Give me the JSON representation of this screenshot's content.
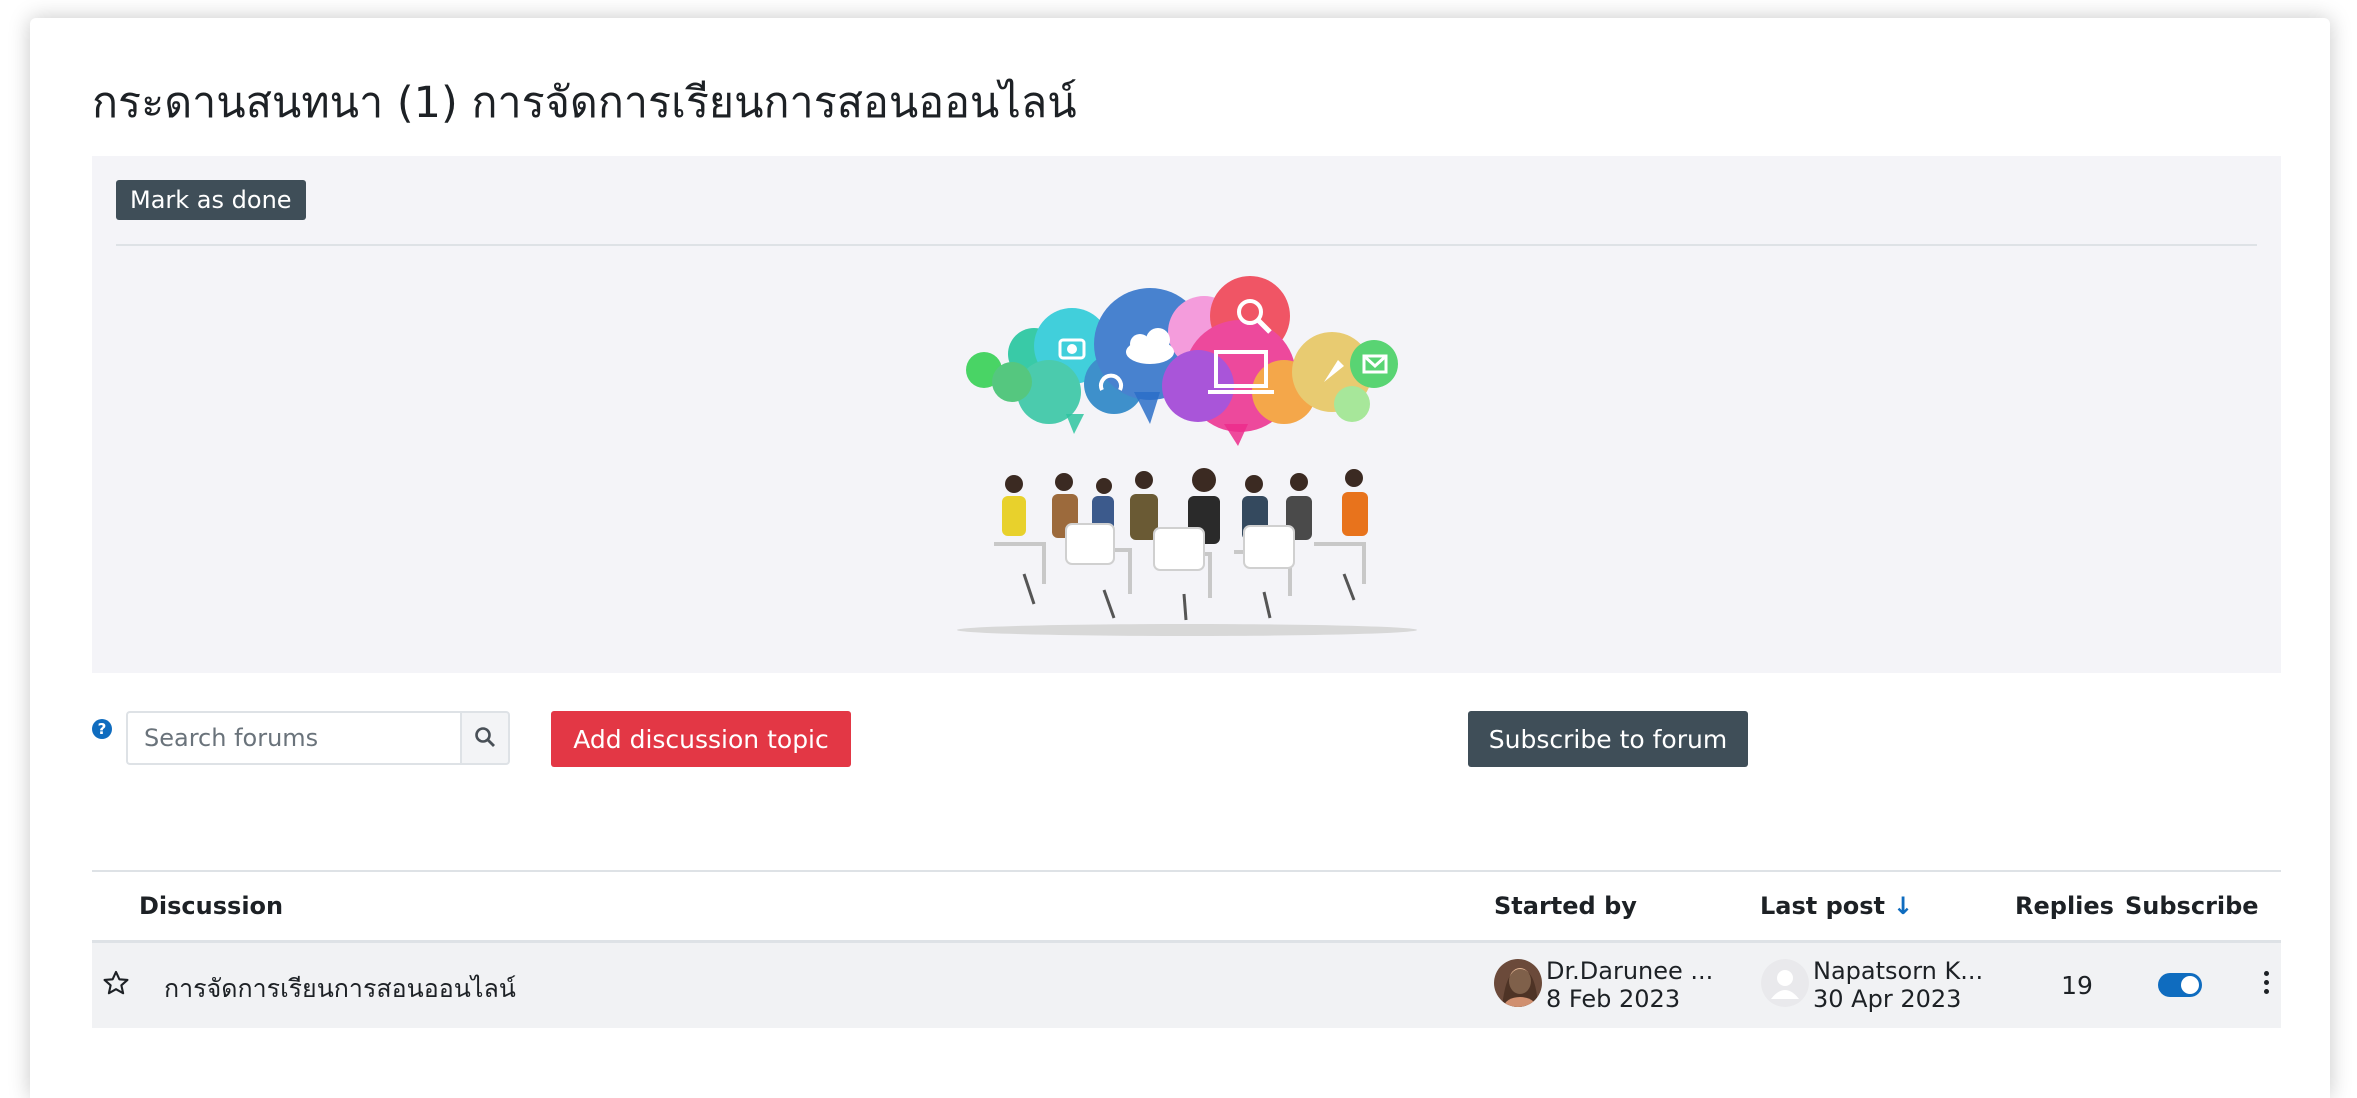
{
  "page": {
    "title": "กระดานสนทนา (1) การจัดการเรียนการสอนออนไลน์"
  },
  "completion": {
    "mark_done_label": "Mark as done"
  },
  "toolbar": {
    "search_placeholder": "Search forums",
    "add_topic_label": "Add discussion topic",
    "subscribe_label": "Subscribe to forum"
  },
  "table": {
    "headers": {
      "discussion": "Discussion",
      "started_by": "Started by",
      "last_post": "Last post",
      "replies": "Replies",
      "subscribe": "Subscribe"
    },
    "rows": [
      {
        "title": "การจัดการเรียนการสอนออนไลน์",
        "started_by_name": "Dr.Darunee ...",
        "started_by_date": "8 Feb 2023",
        "last_post_name": "Napatsorn K...",
        "last_post_date": "30 Apr 2023",
        "replies": "19",
        "subscribed": true
      }
    ]
  },
  "icons": {
    "help": "question-circle-icon",
    "search": "search-icon",
    "sort": "arrow-down-icon",
    "star": "star-outline-icon",
    "menu": "kebab-menu-icon"
  },
  "colors": {
    "primary": "#0f6cbf",
    "danger": "#e33745",
    "dark": "#3f4e58",
    "intro_bg": "#f4f4f8",
    "row_bg": "#f1f2f4"
  }
}
